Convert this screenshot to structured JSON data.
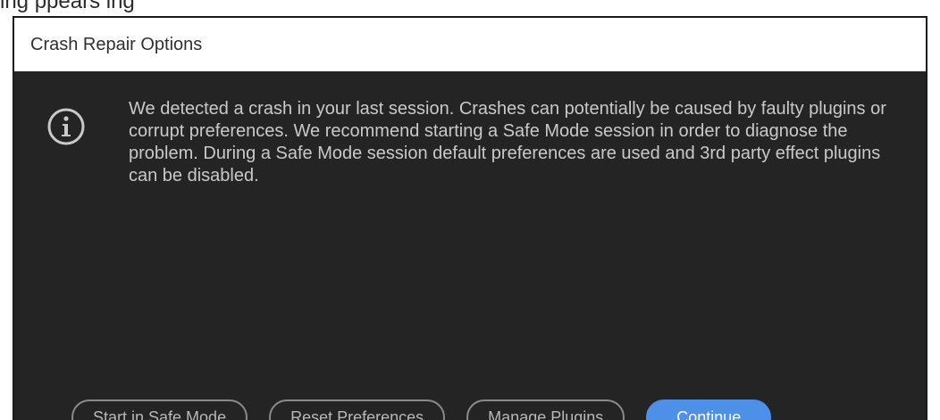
{
  "above_dialog_text": "ing       ppears    ing",
  "dialog": {
    "title": "Crash Repair Options",
    "info_icon": "info-circle-icon",
    "message": "We detected a crash in your last session. Crashes can potentially be caused by faulty plugins or corrupt preferences. We recommend starting a Safe Mode session in order to diagnose the problem. During a Safe Mode session default preferences are used and 3rd party effect plugins can be disabled.",
    "buttons": {
      "safe_mode": "Start in Safe Mode",
      "reset_preferences": "Reset Preferences",
      "manage_plugins": "Manage Plugins",
      "continue": "Continue"
    }
  },
  "colors": {
    "dialog_background": "#242424",
    "titlebar_background": "#ffffff",
    "primary_button": "#4e8fe8",
    "text": "#c9c9c9"
  }
}
